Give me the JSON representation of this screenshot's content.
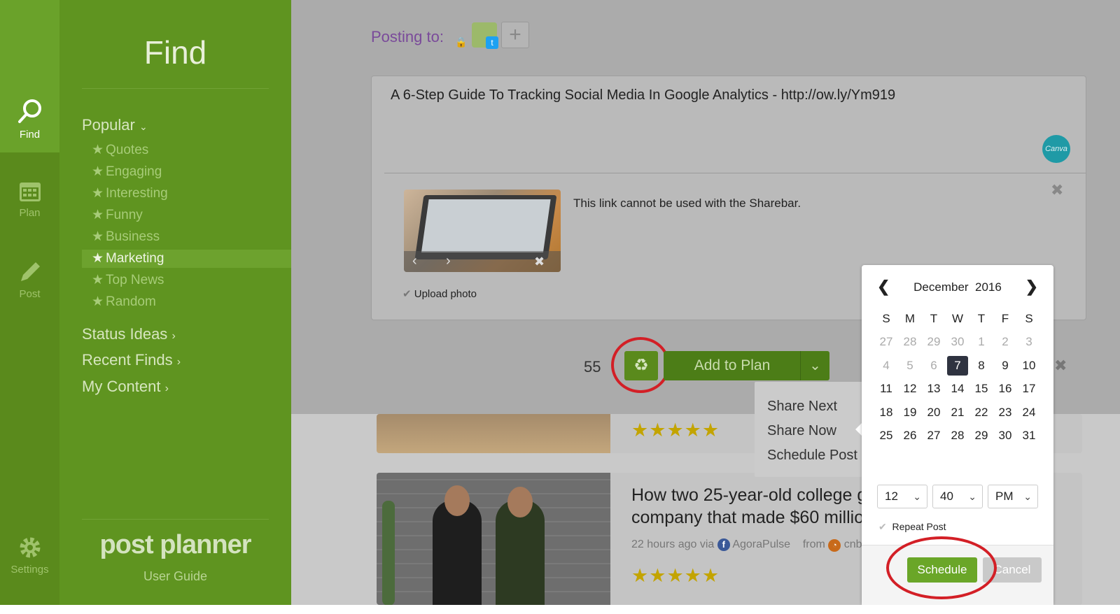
{
  "rail": {
    "items": [
      {
        "label": "Find",
        "icon": "search-icon"
      },
      {
        "label": "Plan",
        "icon": "calendar-icon"
      },
      {
        "label": "Post",
        "icon": "pencil-icon"
      },
      {
        "label": "Settings",
        "icon": "gear-icon"
      }
    ]
  },
  "sidebar": {
    "title": "Find",
    "popular_label": "Popular",
    "popular_items": [
      "Quotes",
      "Engaging",
      "Interesting",
      "Funny",
      "Business",
      "Marketing",
      "Top News",
      "Random"
    ],
    "active_item": "Marketing",
    "sections": [
      "Status Ideas",
      "Recent Finds",
      "My Content"
    ],
    "logo_text": "post planner",
    "user_guide": "User Guide"
  },
  "posting": {
    "label": "Posting to:"
  },
  "composer": {
    "message": "A 6-Step Guide To Tracking Social Media In Google Analytics - http://ow.ly/Ym919",
    "canva_label": "Canva",
    "link_notice": "This link cannot be used with the Sharebar.",
    "upload_label": "Upload photo"
  },
  "actions": {
    "char_count": "55",
    "add_to_plan": "Add to Plan",
    "menu": [
      "Share Next",
      "Share Now",
      "Schedule Post"
    ]
  },
  "feed": {
    "card2_title_line1": "How two 25-year-old college g",
    "card2_title_line2": "company that made $60 millio",
    "card2_meta_time": "22 hours ago via",
    "card2_meta_source": "AgoraPulse",
    "card2_meta_from": "from",
    "card2_meta_feed": "cnb",
    "stars": 5
  },
  "calendar": {
    "month": "December",
    "year": "2016",
    "days_of_week": [
      "S",
      "M",
      "T",
      "W",
      "T",
      "F",
      "S"
    ],
    "weeks": [
      [
        "27",
        "28",
        "29",
        "30",
        "1",
        "2",
        "3"
      ],
      [
        "4",
        "5",
        "6",
        "7",
        "8",
        "9",
        "10"
      ],
      [
        "11",
        "12",
        "13",
        "14",
        "15",
        "16",
        "17"
      ],
      [
        "18",
        "19",
        "20",
        "21",
        "22",
        "23",
        "24"
      ],
      [
        "25",
        "26",
        "27",
        "28",
        "29",
        "30",
        "31"
      ]
    ],
    "selected_day": "7",
    "hour": "12",
    "minute": "40",
    "ampm": "PM",
    "repeat_label": "Repeat Post",
    "schedule_label": "Schedule",
    "cancel_label": "Cancel"
  },
  "colors": {
    "brand_green": "#5f9420",
    "accent_red": "#d31f26",
    "posting_purple": "#7a4a9a"
  }
}
